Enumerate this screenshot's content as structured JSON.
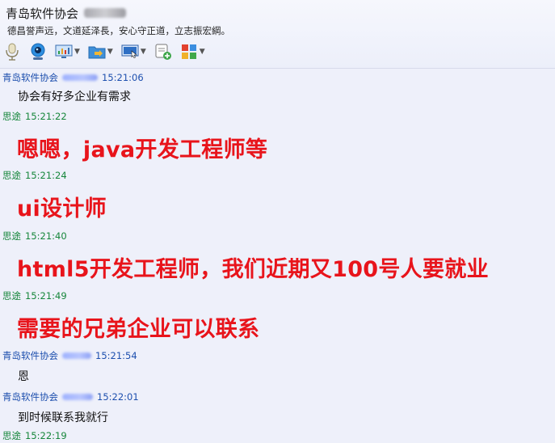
{
  "header": {
    "title": "青岛软件协会",
    "motto": "德昌誉声远，文道延泽長，安心守正道，立志振宏綱。"
  },
  "toolbar": {
    "items": [
      {
        "name": "microphone-icon"
      },
      {
        "name": "webcam-icon"
      },
      {
        "name": "screen-share-icon"
      },
      {
        "name": "send-file-icon"
      },
      {
        "name": "remote-assist-icon"
      },
      {
        "name": "add-app-icon"
      },
      {
        "name": "app-grid-icon"
      }
    ]
  },
  "messages": [
    {
      "sender": "青岛软件协会",
      "time": "15:21:06",
      "text": "协会有好多企业有需求",
      "style": "normal"
    },
    {
      "sender": "思途",
      "time": "15:21:22",
      "text": "嗯嗯，java开发工程师等",
      "style": "big"
    },
    {
      "sender": "思途",
      "time": "15:21:24",
      "text": "ui设计师",
      "style": "big"
    },
    {
      "sender": "思途",
      "time": "15:21:40",
      "text": "html5开发工程师，我们近期又100号人要就业",
      "style": "big"
    },
    {
      "sender": "思途",
      "time": "15:21:49",
      "text": "需要的兄弟企业可以联系",
      "style": "big"
    },
    {
      "sender": "青岛软件协会",
      "time": "15:21:54",
      "text": "恩",
      "style": "normal"
    },
    {
      "sender": "青岛软件协会",
      "time": "15:22:01",
      "text": "到时候联系我就行",
      "style": "normal"
    },
    {
      "sender": "思途",
      "time": "15:22:19",
      "text": "",
      "style": "normal"
    }
  ],
  "colors": {
    "other_sender": "#1d4fae",
    "self_sender": "#16863b",
    "highlight_text": "#e8141b"
  }
}
